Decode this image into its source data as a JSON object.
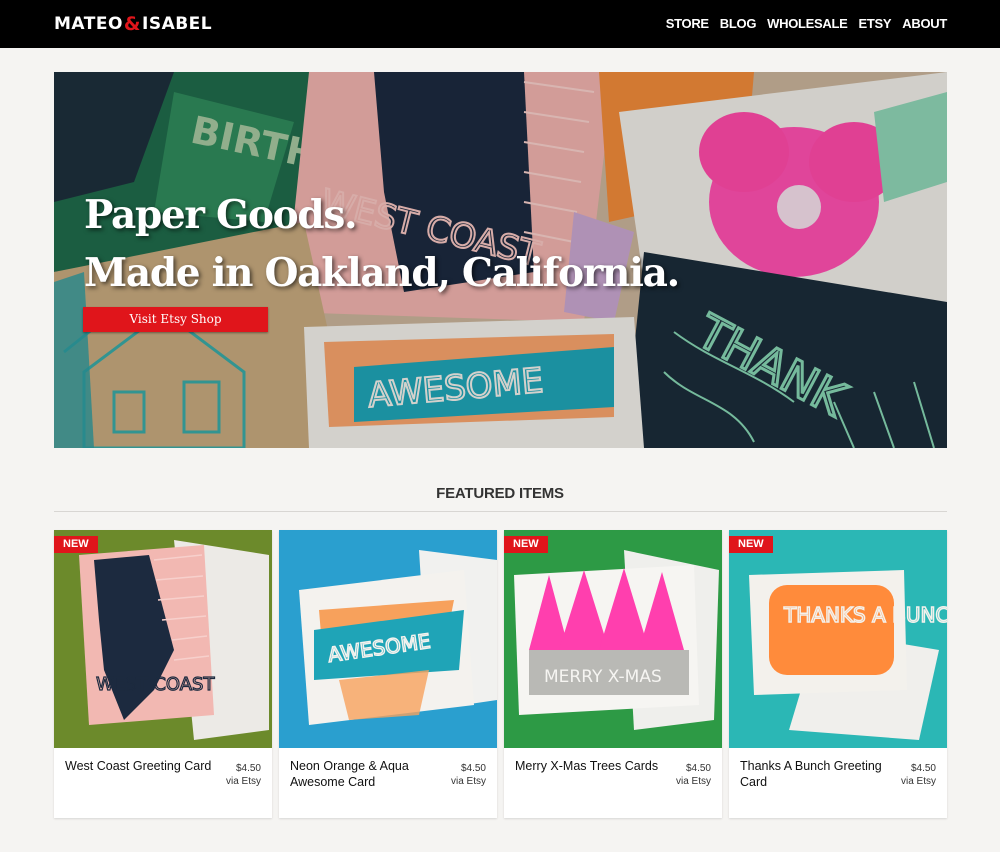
{
  "brand": {
    "left": "MATEO",
    "amp": "&",
    "right": "ISABEL"
  },
  "nav": [
    "STORE",
    "BLOG",
    "WHOLESALE",
    "ETSY",
    "ABOUT"
  ],
  "hero": {
    "line1": "Paper Goods.",
    "line2": "Made in Oakland, California.",
    "button": "Visit Etsy Shop"
  },
  "featured": {
    "title": "FEATURED ITEMS",
    "items": [
      {
        "name": "West Coast Greeting Card",
        "price": "$4.50",
        "source": "via Etsy",
        "badge": "NEW"
      },
      {
        "name": "Neon Orange & Aqua Awesome Card",
        "price": "$4.50",
        "source": "via Etsy",
        "badge": ""
      },
      {
        "name": "Merry X-Mas Trees Cards",
        "price": "$4.50",
        "source": "via Etsy",
        "badge": "NEW"
      },
      {
        "name": "Thanks A Bunch Greeting Card",
        "price": "$4.50",
        "source": "via Etsy",
        "badge": "NEW"
      }
    ]
  },
  "artwork_lettering": [
    "BIRTH",
    "WEST COAST",
    "THANK",
    "THANK YOU",
    "AWESOME",
    "WEST COAST",
    "AWESOME",
    "MERRY X-MAS",
    "THANKS A BUNCH"
  ],
  "colors": {
    "accent": "#e0151b",
    "header_bg": "#000000",
    "page_bg": "#f5f4f2"
  }
}
